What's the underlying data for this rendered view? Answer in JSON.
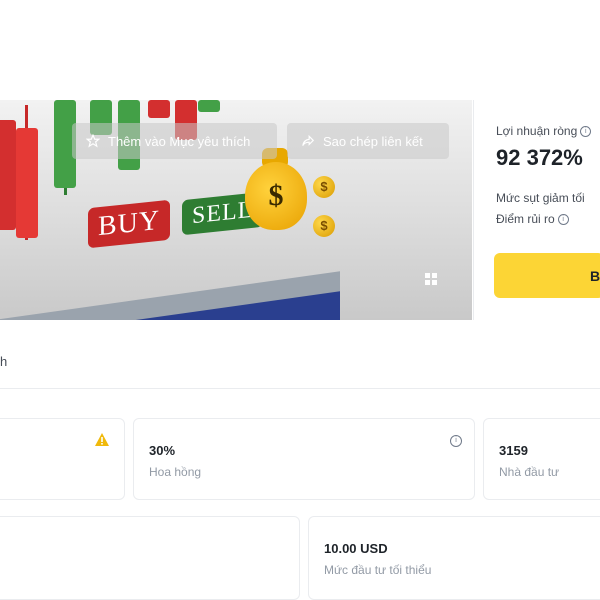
{
  "banner": {
    "favorite_label": "Thêm vào Mục yêu thích",
    "copy_link_label": "Sao chép liên kết",
    "buy_tag": "BUY",
    "sell_tag": "SELL",
    "bag_symbol": "$",
    "coin_symbol": "$"
  },
  "summary": {
    "pnl_label": "Lợi nhuận ròng",
    "pnl_value": "92 372%",
    "drawdown_label": "Mức sụt giảm tối",
    "risk_label": "Điểm rủi ro",
    "cta_label": "Bả"
  },
  "tab_label": "h",
  "stats": {
    "commission_value": "30%",
    "commission_label": "Hoa hồng",
    "investors_value": "3159",
    "investors_label": "Nhà đầu tư",
    "min_invest_value": "10.00 USD",
    "min_invest_label": "Mức đầu tư tối thiểu"
  },
  "colors": {
    "accent": "#fcd535",
    "warning": "#f0b90b",
    "buy": "#c62828",
    "sell": "#2e7d32"
  }
}
